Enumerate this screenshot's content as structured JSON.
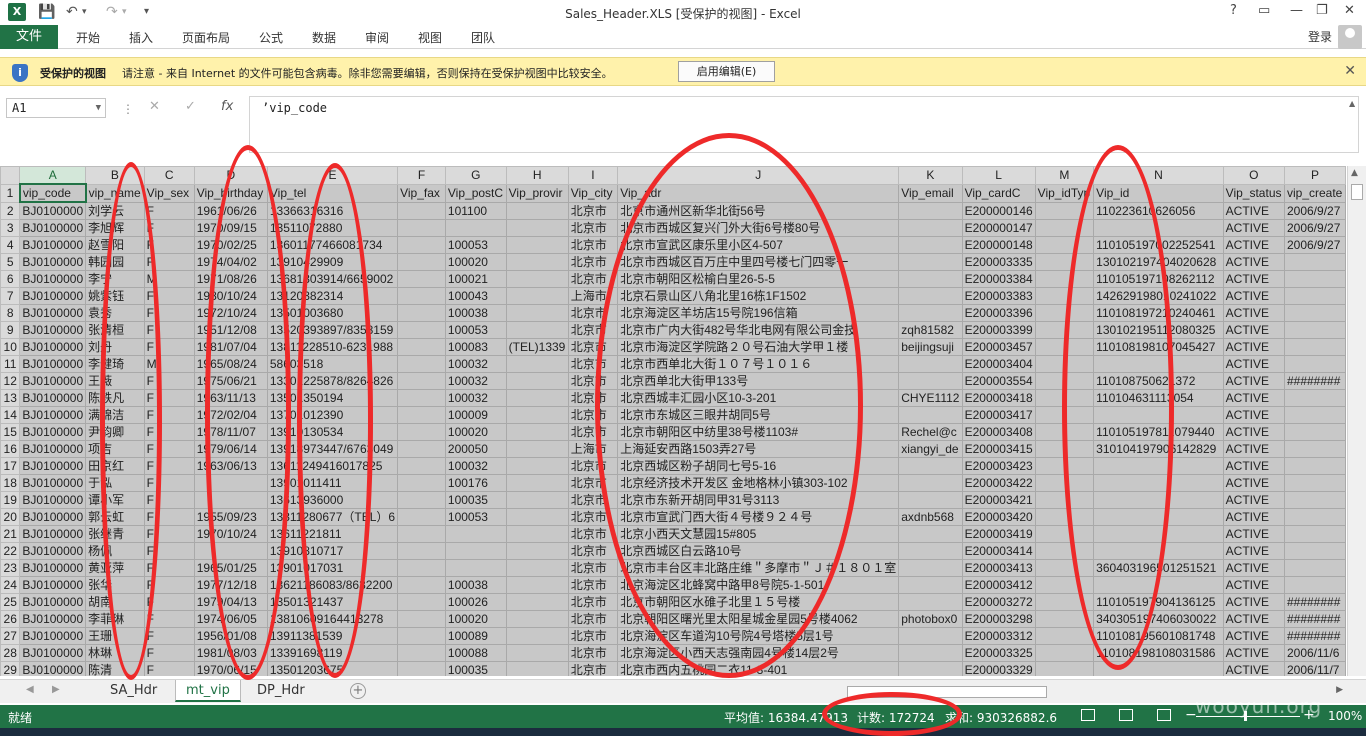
{
  "window": {
    "title": "Sales_Header.XLS  [受保护的视图] - Excel",
    "app_icon": "X",
    "controls": [
      "?",
      "▭",
      "—",
      "❐",
      "✕"
    ]
  },
  "ribbon": {
    "file": "文件",
    "tabs": [
      "开始",
      "插入",
      "页面布局",
      "公式",
      "数据",
      "审阅",
      "视图",
      "团队"
    ],
    "login": "登录"
  },
  "message_bar": {
    "title": "受保护的视图",
    "text": "请注意 - 来自 Internet 的文件可能包含病毒。除非您需要编辑，否则保持在受保护视图中比较安全。",
    "button": "启用编辑(E)"
  },
  "formula_bar": {
    "name_box": "A1",
    "formula": "’vip_code",
    "fx": "fx"
  },
  "columns": [
    "A",
    "B",
    "C",
    "D",
    "E",
    "F",
    "G",
    "H",
    "I",
    "J",
    "K",
    "L",
    "M",
    "N",
    "O",
    "P"
  ],
  "rows": [
    {
      "n": "1",
      "c": [
        "vip_code",
        "vip_name",
        "Vip_sex",
        "Vip_birthday",
        "Vip_tel",
        "Vip_fax",
        "Vip_postC",
        "Vip_provir",
        "Vip_city",
        "Vip_adr",
        "Vip_email",
        "Vip_cardC",
        "Vip_idTyp",
        "Vip_id",
        "Vip_status",
        "vip_create"
      ]
    },
    {
      "n": "2",
      "c": [
        "BJ0100000",
        "刘学云",
        "F",
        "1961/06/26",
        "13366316316",
        "",
        "101100",
        "",
        "北京市",
        "北京市通州区新华北街56号",
        "",
        "E200000146",
        "",
        "110223610626056",
        "ACTIVE",
        "2006/9/27"
      ]
    },
    {
      "n": "3",
      "c": [
        "BJ0100000",
        "李旭辉",
        "F",
        "1970/09/15",
        "13511072880",
        "",
        "",
        "",
        "北京市",
        "北京市西城区复兴门外大街6号楼80号",
        "",
        "E200000147",
        "",
        "",
        "ACTIVE",
        "2006/9/27"
      ]
    },
    {
      "n": "4",
      "c": [
        "BJ0100000",
        "赵雪阳",
        "F",
        "1970/02/25",
        "13601177466081734",
        "",
        "100053",
        "",
        "北京市",
        "北京市宣武区康乐里小区4-507",
        "",
        "E200000148",
        "",
        "110105197002252541",
        "ACTIVE",
        "2006/9/27"
      ]
    },
    {
      "n": "5",
      "c": [
        "BJ0100000",
        "韩园园",
        "F",
        "1974/04/02",
        "13910429909",
        "",
        "100020",
        "",
        "北京市",
        "北京市西城区百万庄中里四号楼七门四零一",
        "",
        "E200003335",
        "",
        "130102197404020628",
        "ACTIVE",
        ""
      ]
    },
    {
      "n": "6",
      "c": [
        "BJ0100000",
        "李宁",
        "M",
        "1971/08/26",
        "13681303914/6659002",
        "",
        "100021",
        "",
        "北京市",
        "北京市朝阳区松榆白里26-5-5",
        "",
        "E200003384",
        "",
        "110105197108262112",
        "ACTIVE",
        ""
      ]
    },
    {
      "n": "7",
      "c": [
        "BJ0100000",
        "姚紫钰",
        "F",
        "1980/10/24",
        "13120382314",
        "",
        "100043",
        "",
        "上海市",
        "北京石景山区八角北里16栋1F1502",
        "",
        "E200003383",
        "",
        "142629198010241022",
        "ACTIVE",
        ""
      ]
    },
    {
      "n": "8",
      "c": [
        "BJ0100000",
        "袁秀",
        "F",
        "1972/10/24",
        "13501003680",
        "",
        "100038",
        "",
        "北京市",
        "北京海淀区羊坊店15号院196信箱",
        "",
        "E200003396",
        "",
        "110108197210240461",
        "ACTIVE",
        ""
      ]
    },
    {
      "n": "9",
      "c": [
        "BJ0100000",
        "张清桓",
        "F",
        "1951/12/08",
        "13520393897/8358159",
        "",
        "100053",
        "",
        "北京市",
        "北京市广内大街482号华北电网有限公司金技",
        "zqh81582",
        "E200003399",
        "",
        "130102195112080325",
        "ACTIVE",
        ""
      ]
    },
    {
      "n": "10",
      "c": [
        "BJ0100000",
        "刘丹",
        "F",
        "1981/07/04",
        "13811228510-6231988",
        "",
        "100083",
        "(TEL)1339",
        "北京市",
        "北京市海淀区学院路２０号石油大学甲１楼",
        "beijingsuji",
        "E200003457",
        "",
        "110108198107045427",
        "ACTIVE",
        ""
      ]
    },
    {
      "n": "11",
      "c": [
        "BJ0100000",
        "李健琦",
        "M",
        "1965/08/24",
        "58603518",
        "",
        "100032",
        "",
        "北京市",
        "北京市西单北大街１０７号１０１６",
        "",
        "E200003404",
        "",
        "",
        "ACTIVE",
        ""
      ]
    },
    {
      "n": "12",
      "c": [
        "BJ0100000",
        "王薇",
        "F",
        "1975/06/21",
        "13301225878/8264826",
        "",
        "100032",
        "",
        "北京市",
        "北京西单北大街甲133号",
        "",
        "E200003554",
        "",
        "110108750621372",
        "ACTIVE",
        "########"
      ]
    },
    {
      "n": "13",
      "c": [
        "BJ0100000",
        "陈轶凡",
        "F",
        "1963/11/13",
        "13501350194",
        "",
        "100032",
        "",
        "北京市",
        "北京西城丰汇园小区10-3-201",
        "CHYE1112",
        "E200003418",
        "",
        "110104631113054",
        "ACTIVE",
        ""
      ]
    },
    {
      "n": "14",
      "c": [
        "BJ0100000",
        "满锦洁",
        "F",
        "1972/02/04",
        "13701012390",
        "",
        "100009",
        "",
        "北京市",
        "北京市东城区三眼井胡同5号",
        "",
        "E200003417",
        "",
        "",
        "ACTIVE",
        ""
      ]
    },
    {
      "n": "15",
      "c": [
        "BJ0100000",
        "尹韵卿",
        "F",
        "1978/11/07",
        "13910130534",
        "",
        "100020",
        "",
        "北京市",
        "北京市朝阳区中纺里38号楼1103#",
        "Rechel@c",
        "E200003408",
        "",
        "110105197811079440",
        "ACTIVE",
        ""
      ]
    },
    {
      "n": "16",
      "c": [
        "BJ0100000",
        "项吉",
        "F",
        "1979/06/14",
        "13918973447/6763049",
        "",
        "200050",
        "",
        "上海市",
        "上海延安西路1503弄27号",
        "xiangyi_de",
        "E200003415",
        "",
        "310104197906142829",
        "ACTIVE",
        ""
      ]
    },
    {
      "n": "17",
      "c": [
        "BJ0100000",
        "田京红",
        "F",
        "1963/06/13",
        "13611249416017825",
        "",
        "100032",
        "",
        "北京市",
        "北京西城区粉子胡同七号5-16",
        "",
        "E200003423",
        "",
        "",
        "ACTIVE",
        ""
      ]
    },
    {
      "n": "18",
      "c": [
        "BJ0100000",
        "于泓",
        "F",
        "",
        "13901011411",
        "",
        "100176",
        "",
        "北京市",
        "北京经济技术开发区 金地格林小镇303-102",
        "",
        "E200003422",
        "",
        "",
        "ACTIVE",
        ""
      ]
    },
    {
      "n": "19",
      "c": [
        "BJ0100000",
        "谭小军",
        "F",
        "",
        "13613936000",
        "",
        "100035",
        "",
        "北京市",
        "北京市东新开胡同甲31号3113",
        "",
        "E200003421",
        "",
        "",
        "ACTIVE",
        ""
      ]
    },
    {
      "n": "20",
      "c": [
        "BJ0100000",
        "郭云虹",
        "F",
        "1955/09/23",
        "13311280677（TEL）6",
        "",
        "100053",
        "",
        "北京市",
        "北京市宣武门西大街４号楼９２４号",
        "axdnb568",
        "E200003420",
        "",
        "",
        "ACTIVE",
        ""
      ]
    },
    {
      "n": "21",
      "c": [
        "BJ0100000",
        "张继青",
        "F",
        "1970/10/24",
        "13611221811",
        "",
        "",
        "",
        "北京市",
        "北京小西天文慧园15#805",
        "",
        "E200003419",
        "",
        "",
        "ACTIVE",
        ""
      ]
    },
    {
      "n": "22",
      "c": [
        "BJ0100000",
        "杨佩",
        "F",
        "",
        "13910810717",
        "",
        "",
        "",
        "北京市",
        "北京西城区白云路10号",
        "",
        "E200003414",
        "",
        "",
        "ACTIVE",
        ""
      ]
    },
    {
      "n": "23",
      "c": [
        "BJ0100000",
        "黄亚萍",
        "F",
        "1965/01/25",
        "13901017031",
        "",
        "",
        "",
        "北京市",
        "北京市丰台区丰北路庄维＂多摩市＂Ｊ＃１８０１室",
        "",
        "E200003413",
        "",
        "360403196501251521",
        "ACTIVE",
        ""
      ]
    },
    {
      "n": "24",
      "c": [
        "BJ0100000",
        "张华",
        "F",
        "1977/12/18",
        "13621186083/8632200",
        "",
        "100038",
        "",
        "北京市",
        "北京海淀区北蜂窝中路甲8号院5-1-501",
        "",
        "E200003412",
        "",
        "",
        "ACTIVE",
        ""
      ]
    },
    {
      "n": "25",
      "c": [
        "BJ0100000",
        "胡南",
        "F",
        "1979/04/13",
        "13501321437",
        "",
        "100026",
        "",
        "北京市",
        "北京市朝阳区水碓子北里１５号楼",
        "",
        "E200003272",
        "",
        "110105197904136125",
        "ACTIVE",
        "########"
      ]
    },
    {
      "n": "26",
      "c": [
        "BJ0100000",
        "李菲琳",
        "F",
        "1974/06/05",
        "13810609164413278",
        "",
        "100020",
        "",
        "北京市",
        "北京朝阳区曙光里太阳星城金星园5号楼4062",
        "photobox0",
        "E200003298",
        "",
        "340305197406030022",
        "ACTIVE",
        "########"
      ]
    },
    {
      "n": "27",
      "c": [
        "BJ0100000",
        "王珊",
        "F",
        "1956/01/08",
        "13911381539",
        "",
        "100089",
        "",
        "北京市",
        "北京海淀区车道沟10号院4号塔楼5层1号",
        "",
        "E200003312",
        "",
        "110108195601081748",
        "ACTIVE",
        "########"
      ]
    },
    {
      "n": "28",
      "c": [
        "BJ0100000",
        "林琳",
        "F",
        "1981/08/03",
        "13391698119",
        "",
        "100088",
        "",
        "北京市",
        "北京海淀区小西天志强南园4号楼14层2号",
        "",
        "E200003325",
        "",
        "110108198108031586",
        "ACTIVE",
        "2006/11/6"
      ]
    },
    {
      "n": "29",
      "c": [
        "BJ0100000",
        "陈清",
        "F",
        "1970/06/15",
        "13501203675",
        "",
        "100035",
        "",
        "北京市",
        "北京市西内五桃园二衣11-3-401",
        "",
        "E200003329",
        "",
        "",
        "ACTIVE",
        "2006/11/7"
      ]
    }
  ],
  "sheet_tabs": [
    "SA_Hdr",
    "mt_vip",
    "DP_Hdr"
  ],
  "active_sheet": "mt_vip",
  "status": {
    "ready": "就绪",
    "average": "平均值: 16384.47913",
    "count": "计数: 172724",
    "sum": "求和: 930326882.6",
    "zoom": "100%"
  },
  "watermark": "wooyun.org",
  "colors": {
    "excel_green": "#217346",
    "cell_gray": "#c8c8c8",
    "message_bar": "#fff2ab",
    "annotation_red": "#ee2a2a"
  }
}
